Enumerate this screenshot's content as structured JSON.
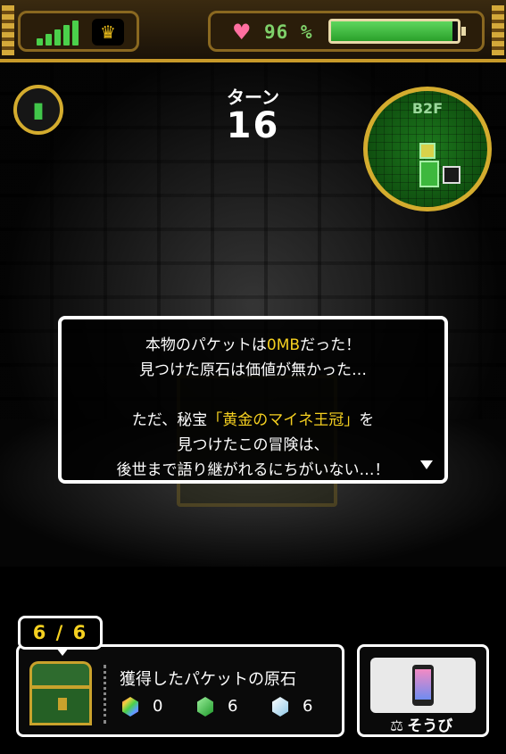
{
  "status_bar": {
    "signal_icon": "signal-bars-icon",
    "crown_icon": "crown-icon",
    "health_percent": 96,
    "health_display": "96 %",
    "heart_icon": "heart-icon",
    "colors": {
      "health": "#7fd06a",
      "gold_frame": "#c89a2a"
    }
  },
  "turn": {
    "label": "ターン",
    "value": "16"
  },
  "minimap": {
    "floor": "B2F"
  },
  "dialog": {
    "lines": [
      {
        "pre": "本物のパケットは",
        "highlight": "0MB",
        "post": "だった！"
      },
      {
        "pre": "見つけた原石は価値が無かった…",
        "highlight": "",
        "post": ""
      },
      {
        "pre": "ただ、秘宝",
        "highlight": "「黄金のマイネ王冠」",
        "post": "を"
      },
      {
        "pre": "見つけたこの冒険は、",
        "highlight": "",
        "post": ""
      },
      {
        "pre": "後世まで語り継がれるにちがいない…！",
        "highlight": "",
        "post": ""
      }
    ],
    "highlight_color": "#f5d020"
  },
  "inventory": {
    "count": "6 / 6",
    "title": "獲得したパケットの原石",
    "gems": [
      {
        "icon": "rainbow-gem-icon",
        "value": "0"
      },
      {
        "icon": "green-gem-icon",
        "value": "6"
      },
      {
        "icon": "blue-gem-icon",
        "value": "6"
      }
    ]
  },
  "equipment": {
    "label": "そうび",
    "item_icon": "smartphone-icon"
  }
}
